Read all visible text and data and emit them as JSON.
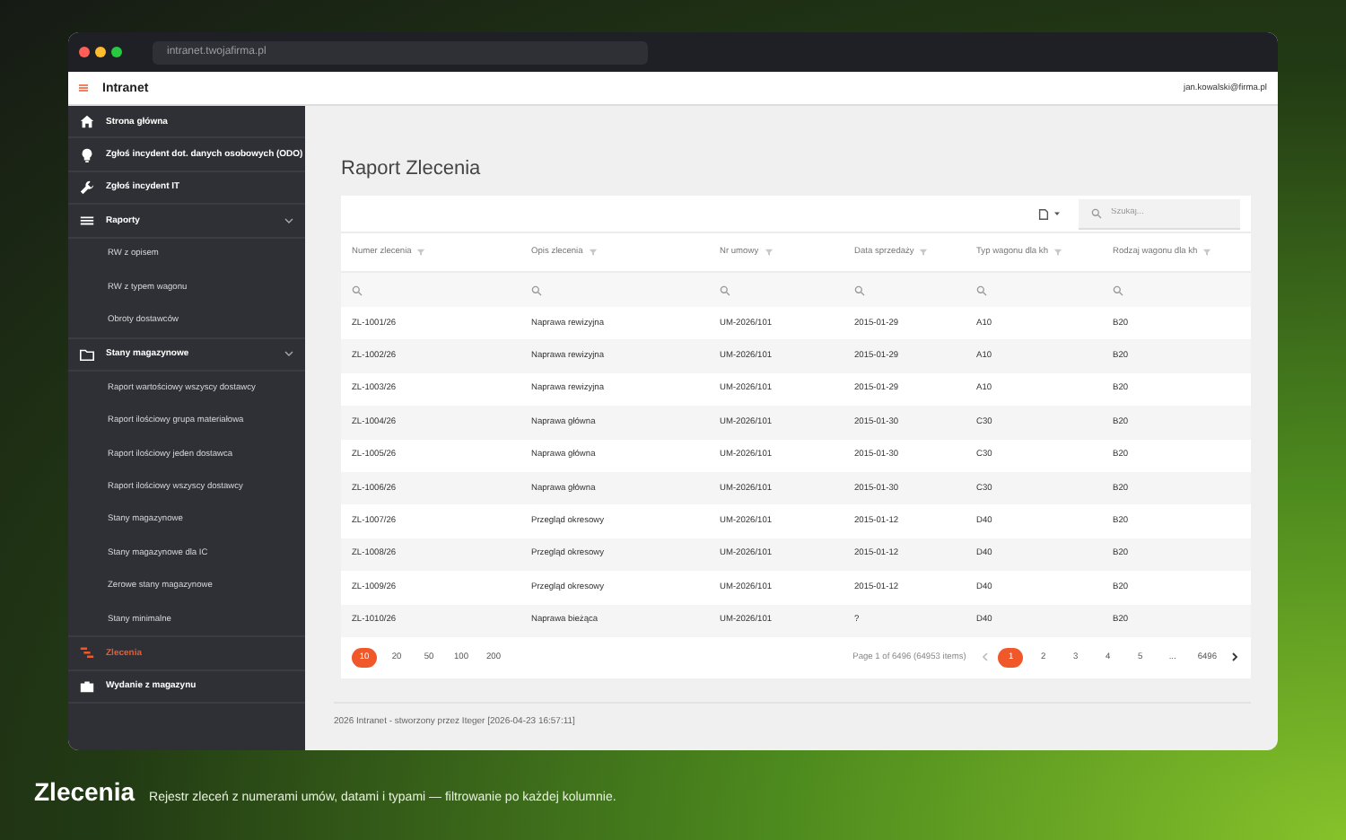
{
  "browser": {
    "url": "intranet.twojafirma.pl"
  },
  "app": {
    "title": "Intranet",
    "user": "jan.kowalski@firma.pl"
  },
  "sidebar": {
    "items": [
      {
        "label": "Strona główna",
        "selected": false
      },
      {
        "label": "Zgłoś incydent dot. danych osobowych (ODO)",
        "selected": false
      },
      {
        "label": "Zgłoś incydent IT",
        "selected": false
      },
      {
        "label": "Raporty",
        "selected": false,
        "expanded": true,
        "children": [
          {
            "label": "RW z opisem",
            "selected": false
          },
          {
            "label": "RW z typem wagonu",
            "selected": false
          },
          {
            "label": "Obroty dostawców",
            "selected": false
          }
        ]
      },
      {
        "label": "Stany magazynowe",
        "selected": false,
        "expanded": true,
        "children": [
          {
            "label": "Raport wartościowy wszyscy dostawcy",
            "selected": false
          },
          {
            "label": "Raport ilościowy grupa materiałowa",
            "selected": false
          },
          {
            "label": "Raport ilościowy jeden dostawca",
            "selected": false
          },
          {
            "label": "Raport ilościowy wszyscy dostawcy",
            "selected": false
          },
          {
            "label": "Stany magazynowe",
            "selected": false
          },
          {
            "label": "Stany magazynowe dla IC",
            "selected": false
          },
          {
            "label": "Zerowe stany magazynowe",
            "selected": false
          },
          {
            "label": "Stany minimalne",
            "selected": false
          }
        ]
      },
      {
        "label": "Zlecenia",
        "selected": true
      },
      {
        "label": "Wydanie z magazynu",
        "selected": false
      }
    ]
  },
  "page": {
    "title": "Raport Zlecenia"
  },
  "toolbar": {
    "search": {
      "placeholder": "Szukaj..."
    }
  },
  "table": {
    "columns": [
      "Numer zlecenia",
      "Opis zlecenia",
      "Nr umowy",
      "Data sprzedaży",
      "Typ wagonu dla kh",
      "Rodzaj wagonu dla kh"
    ],
    "rows": [
      [
        "ZL-1001/26",
        "Naprawa rewizyjna",
        "UM-2026/101",
        "2015-01-29",
        "A10",
        "B20"
      ],
      [
        "ZL-1002/26",
        "Naprawa rewizyjna",
        "UM-2026/101",
        "2015-01-29",
        "A10",
        "B20"
      ],
      [
        "ZL-1003/26",
        "Naprawa rewizyjna",
        "UM-2026/101",
        "2015-01-29",
        "A10",
        "B20"
      ],
      [
        "ZL-1004/26",
        "Naprawa główna",
        "UM-2026/101",
        "2015-01-30",
        "C30",
        "B20"
      ],
      [
        "ZL-1005/26",
        "Naprawa główna",
        "UM-2026/101",
        "2015-01-30",
        "C30",
        "B20"
      ],
      [
        "ZL-1006/26",
        "Naprawa główna",
        "UM-2026/101",
        "2015-01-30",
        "C30",
        "B20"
      ],
      [
        "ZL-1007/26",
        "Przegląd okresowy",
        "UM-2026/101",
        "2015-01-12",
        "D40",
        "B20"
      ],
      [
        "ZL-1008/26",
        "Przegląd okresowy",
        "UM-2026/101",
        "2015-01-12",
        "D40",
        "B20"
      ],
      [
        "ZL-1009/26",
        "Przegląd okresowy",
        "UM-2026/101",
        "2015-01-12",
        "D40",
        "B20"
      ],
      [
        "ZL-1010/26",
        "Naprawa bieżąca",
        "UM-2026/101",
        "?",
        "D40",
        "B20"
      ]
    ]
  },
  "pager": {
    "page_sizes": [
      {
        "label": "10",
        "selected": true
      },
      {
        "label": "20",
        "selected": false
      },
      {
        "label": "50",
        "selected": false
      },
      {
        "label": "100",
        "selected": false
      },
      {
        "label": "200",
        "selected": false
      }
    ],
    "info": "Page 1 of 6496 (64953 items)",
    "pages": [
      {
        "label": "1",
        "selected": true
      },
      {
        "label": "2",
        "selected": false
      },
      {
        "label": "3",
        "selected": false
      },
      {
        "label": "4",
        "selected": false
      },
      {
        "label": "5",
        "selected": false
      },
      {
        "label": "...",
        "selected": false
      },
      {
        "label": "6496",
        "selected": false
      }
    ]
  },
  "footer": "2026 Intranet - stworzony przez Iteger [2026-04-23 16:57:11]",
  "caption": {
    "title": "Zlecenia",
    "text": "Rejestr zleceń z numerami umów, datami i typami — filtrowanie po każdej kolumnie."
  }
}
